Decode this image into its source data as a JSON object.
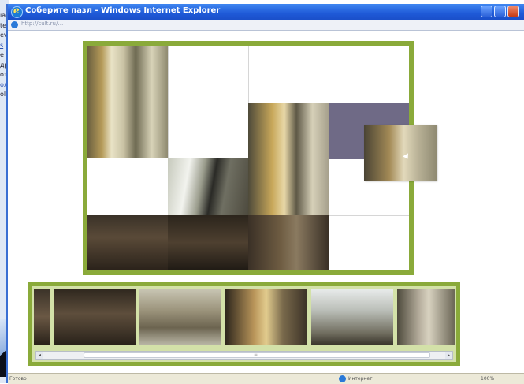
{
  "window": {
    "title": "Соберите пазл - Windows Internet Explorer",
    "address": "http://cult.ru/…",
    "colors": {
      "title_bar": "#1f5ad8",
      "frame_accent": "#8aaa3a",
      "empty_slot": "#6f6a86"
    }
  },
  "background_window": {
    "lines": [
      "ia",
      "te",
      "ev",
      "s",
      "e",
      "др",
      "от",
      "ол",
      "ol"
    ]
  },
  "puzzle": {
    "rows": 3,
    "cols": 4,
    "placed_pieces": 9,
    "empty_slot_highlight": "row 1, column 4"
  },
  "tray": {
    "thumb_count": 6,
    "scroll_position": 0.1
  },
  "statusbar": {
    "ready": "Готово",
    "zone": "Интернет",
    "protected": "",
    "zoom": "100%"
  },
  "icons": [
    "ie-logo-icon",
    "page-icon",
    "minimize-icon",
    "maximize-icon",
    "close-icon",
    "cursor-icon",
    "globe-icon"
  ]
}
